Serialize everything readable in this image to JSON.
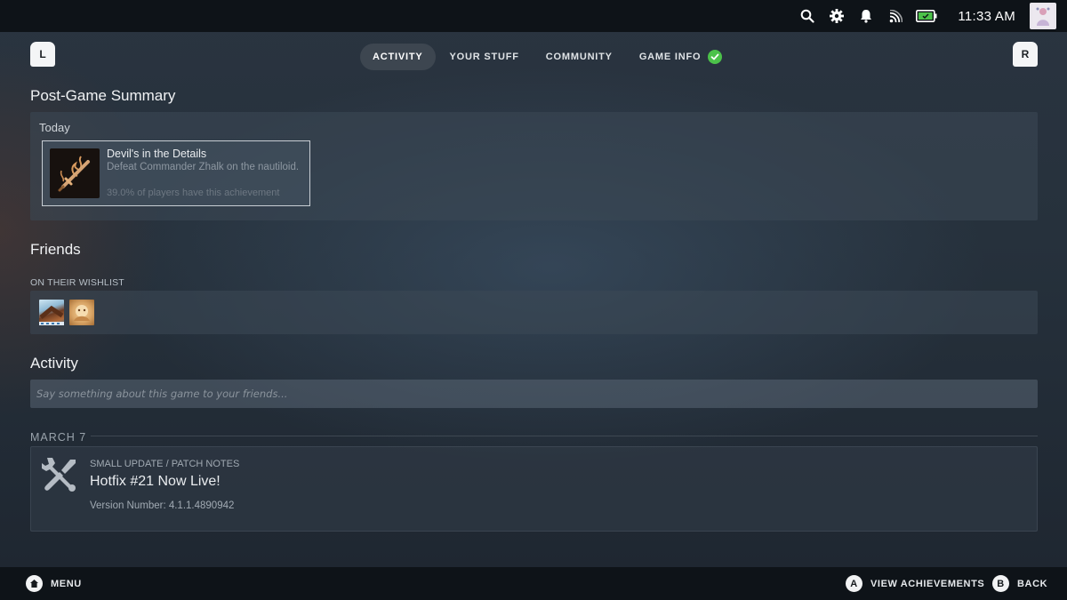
{
  "status_bar": {
    "icons": [
      "search-icon",
      "gear-icon",
      "bell-icon",
      "wifi-icon",
      "battery-icon"
    ],
    "time": "11:33 AM",
    "avatar": "user-avatar"
  },
  "shoulder": {
    "left": "L",
    "right": "R"
  },
  "tabs": [
    {
      "label": "ACTIVITY",
      "active": true
    },
    {
      "label": "YOUR STUFF"
    },
    {
      "label": "COMMUNITY"
    },
    {
      "label": "GAME INFO",
      "icon": "check-circle-icon"
    }
  ],
  "post_game": {
    "title": "Post-Game Summary",
    "group": "Today",
    "achievement": {
      "name": "Devil's in the Details",
      "description": "Defeat Commander Zhalk on the nautiloid.",
      "percent_text": "39.0% of players have this achievement",
      "icon": "sword-flame-icon"
    }
  },
  "friends": {
    "title": "Friends",
    "wishlist_label": "ON THEIR WISHLIST",
    "wishlist_items": [
      "wishlist-game-1",
      "wishlist-game-2"
    ]
  },
  "activity": {
    "title": "Activity",
    "input_placeholder": "Say something about this game to your friends...",
    "date": "MARCH 7",
    "news": {
      "type": "SMALL UPDATE / PATCH NOTES",
      "title": "Hotfix #21 Now Live!",
      "version": "Version Number: 4.1.1.4890942",
      "icon": "wrench-screwdriver-icon"
    }
  },
  "bottom_bar": {
    "menu_label": "MENU",
    "a_button": "A",
    "view_achievements_label": "VIEW ACHIEVEMENTS",
    "b_button": "B",
    "back_label": "BACK"
  },
  "colors": {
    "accent_green": "#4cc24a",
    "bar_bg": "#0e1318",
    "panel_bg": "#36414d"
  }
}
